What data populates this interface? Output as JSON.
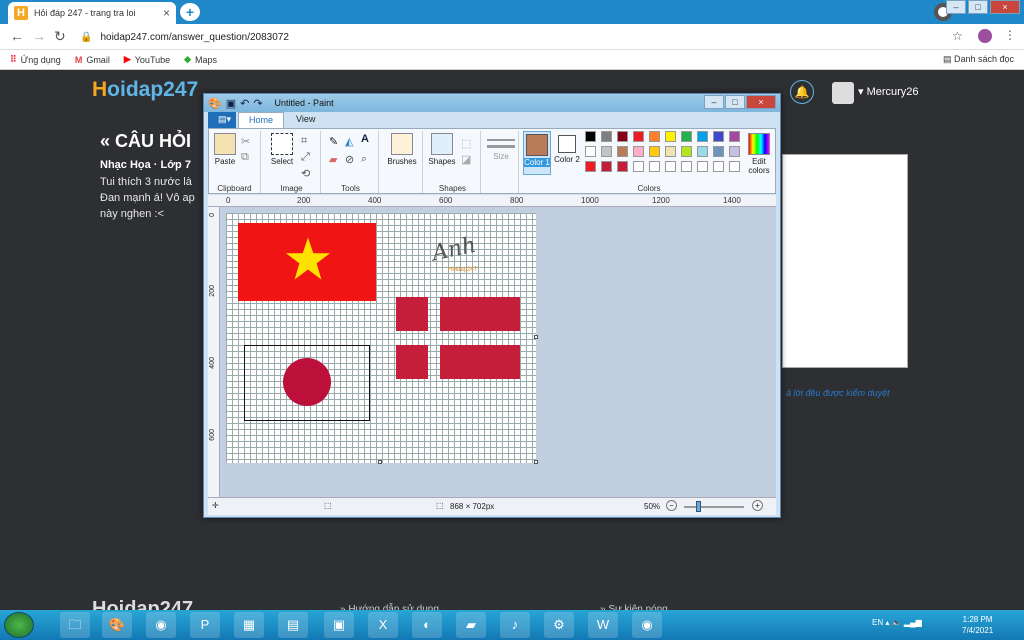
{
  "browser": {
    "tab_title": "Hỏi đáp 247 - trang tra loi",
    "tab_favicon": "H",
    "new_tab": "+",
    "url": "hoidap247.com/answer_question/2083072",
    "bookmarks": [
      "Ứng dụng",
      "Gmail",
      "YouTube",
      "Maps"
    ],
    "reading_list": "Danh sách đọc"
  },
  "site": {
    "logo_h": "H",
    "logo_rest": "oidap247",
    "question_title": "« CÂU HỎI",
    "subject": "Nhạc Họa · Lớp 7",
    "question_lines": [
      "Tui thích 3 nước là",
      "Đan mạnh á! Vô ap",
      "này nghen :<"
    ],
    "username": "Mercury26",
    "note": "ả lời đều được kiểm duyệt",
    "footer_logo": "Hoidap247",
    "footer_link1": "» Hướng dẫn sử dụng",
    "footer_link2": "» Sự kiện nóng"
  },
  "paint": {
    "title": "Untitled - Paint",
    "tabs": [
      "Home",
      "View"
    ],
    "groups": {
      "clipboard": "Clipboard",
      "image": "Image",
      "tools": "Tools",
      "shapes": "Shapes",
      "colors": "Colors"
    },
    "buttons": {
      "paste": "Paste",
      "select": "Select",
      "brushes": "Brushes",
      "shapes": "Shapes",
      "size": "Size",
      "color1": "Color 1",
      "color2": "Color 2",
      "edit_colors": "Edit colors"
    },
    "ruler_ticks": [
      "0",
      "200",
      "400",
      "600",
      "800",
      "1000",
      "1200",
      "1400"
    ],
    "vruler_ticks": [
      "0",
      "200",
      "400",
      "600"
    ],
    "canvas_watermark": "Hoidap247",
    "status_size": "868 × 702px",
    "zoom": "50%",
    "zoom_minus": "−",
    "zoom_plus": "+",
    "palette": [
      "#000000",
      "#7f7f7f",
      "#880015",
      "#ed1c24",
      "#ff7f27",
      "#fff200",
      "#22b14c",
      "#00a2e8",
      "#3f48cc",
      "#a349a4",
      "#ffffff",
      "#c3c3c3",
      "#b97a57",
      "#ffaec9",
      "#ffc90e",
      "#efe4b0",
      "#b5e61d",
      "#99d9ea",
      "#7092be",
      "#c8bfe7",
      "#ed1c24",
      "#c41e3a",
      "#c41e3a",
      "#ffffff",
      "#ffffff",
      "#ffffff",
      "#ffffff",
      "#ffffff",
      "#ffffff",
      "#ffffff"
    ],
    "color1": "#b97a57",
    "color2": "#ffffff",
    "flag_colors": {
      "red": "#f01414",
      "star": "#ffe100",
      "jp_red": "#bc0f3a",
      "dk_red": "#c41e3a"
    }
  },
  "taskbar": {
    "lang": "EN",
    "time": "1:28 PM",
    "date": "7/4/2021"
  }
}
